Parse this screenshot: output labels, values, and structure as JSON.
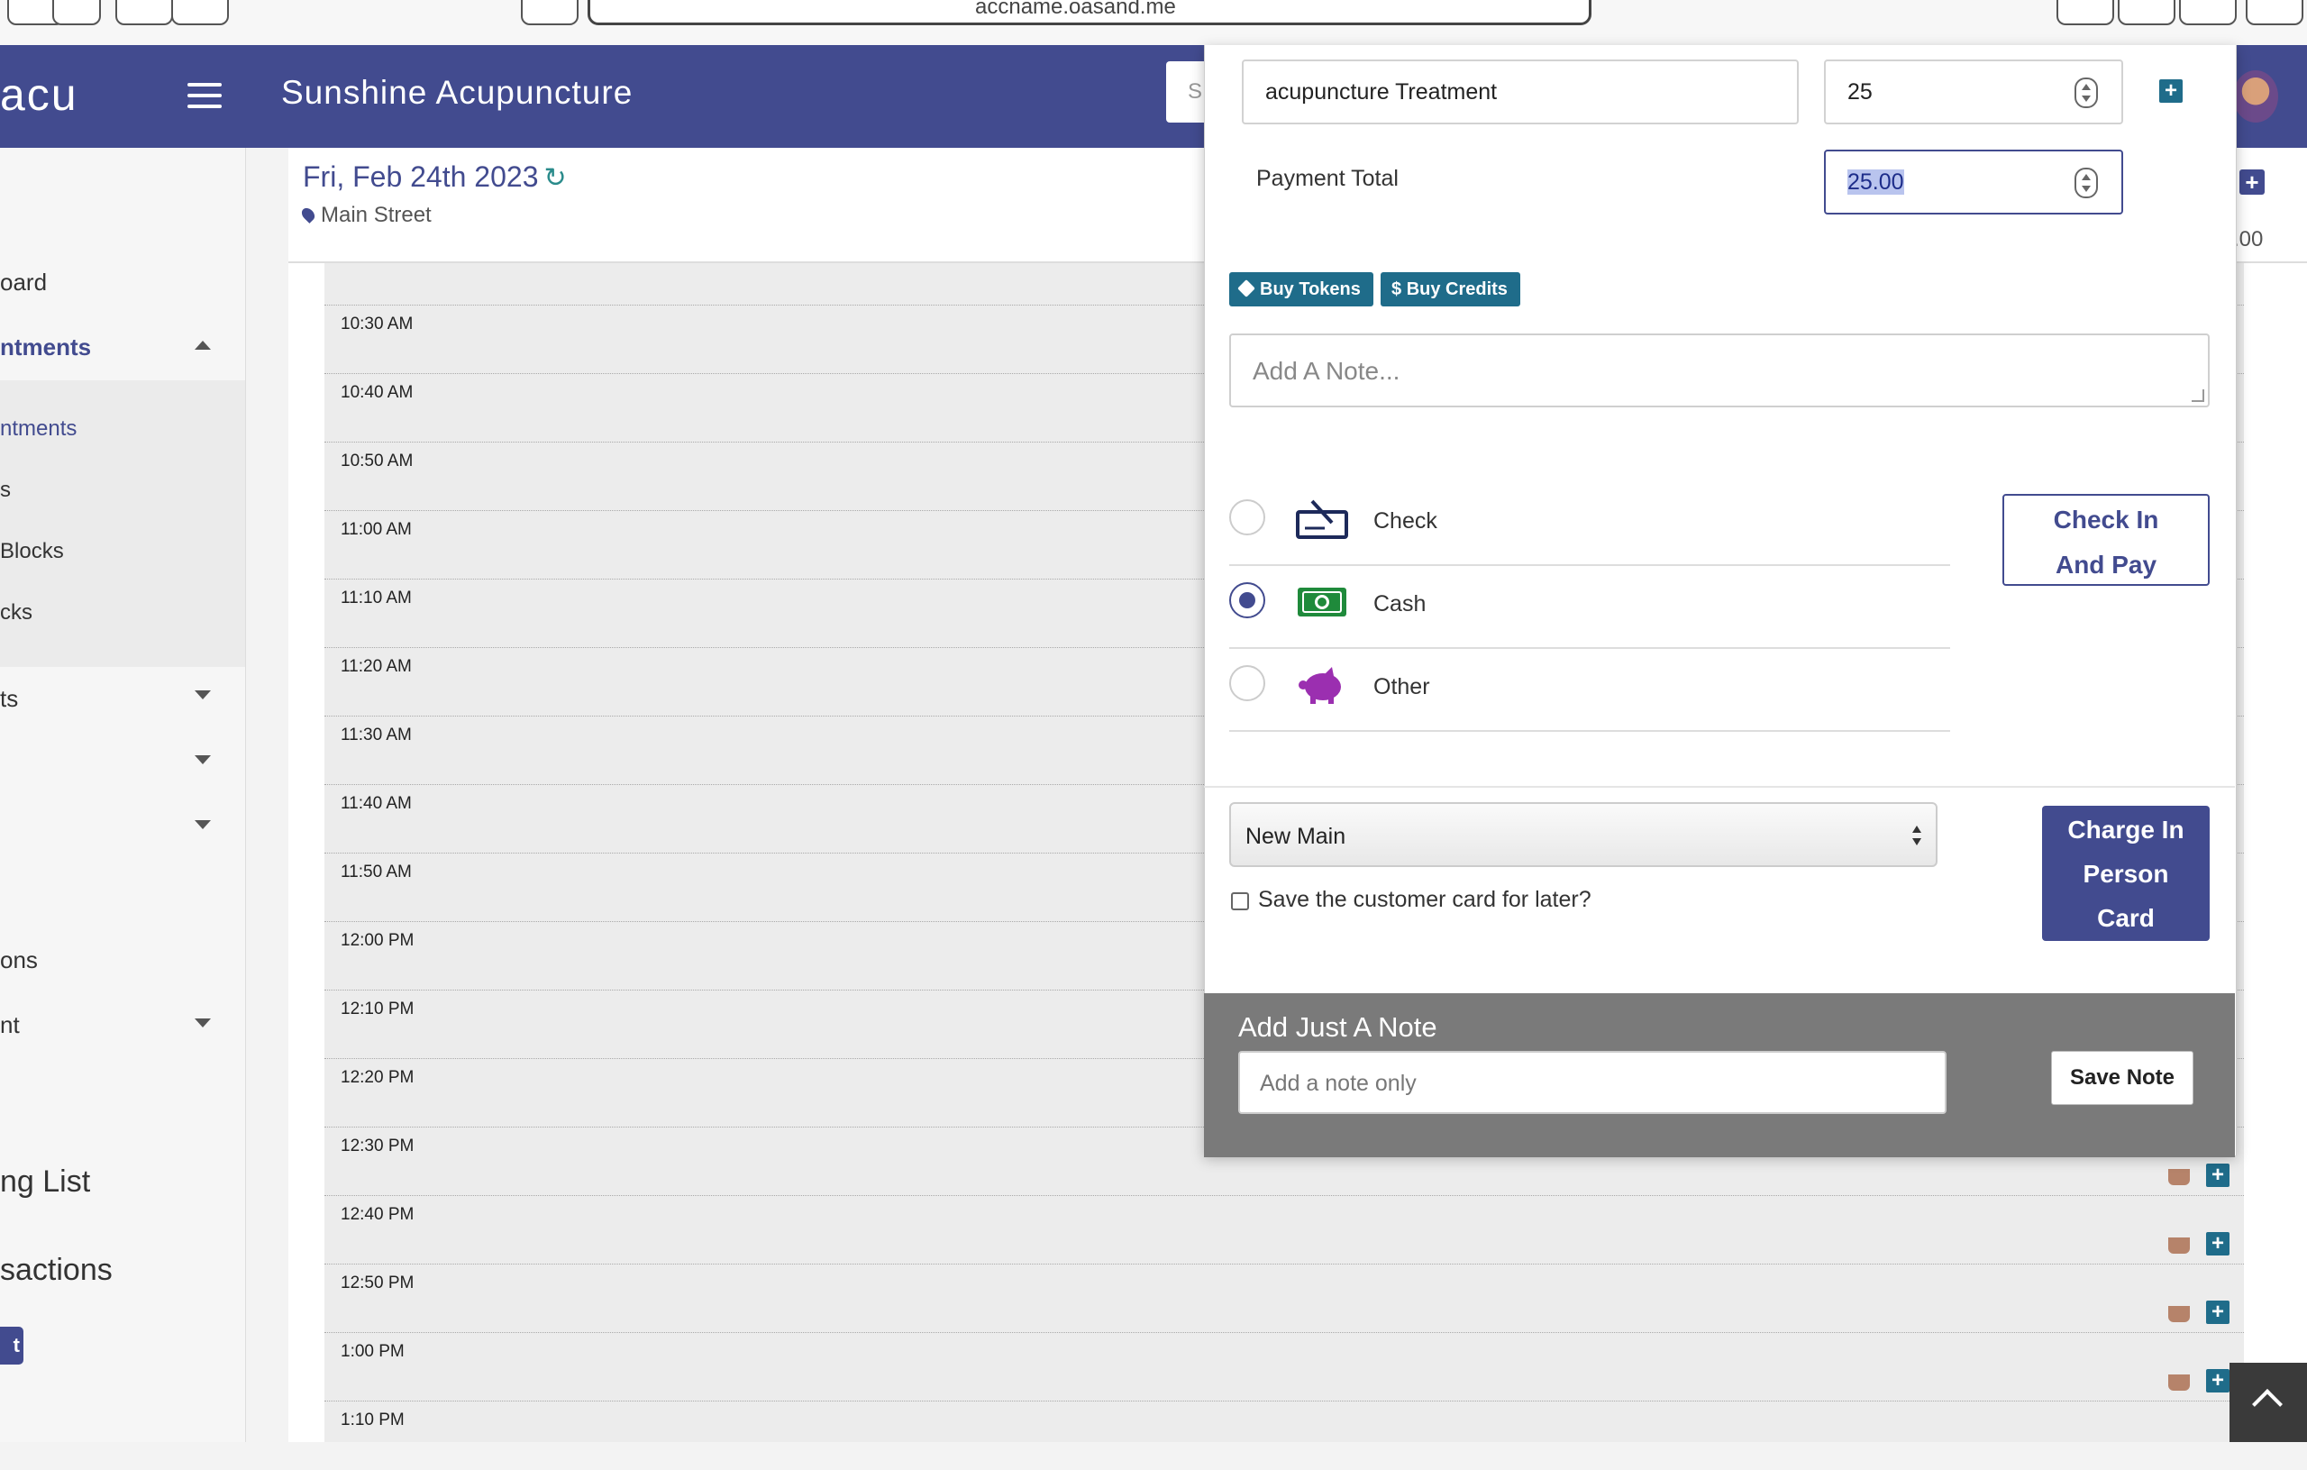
{
  "browser": {
    "url": "accname.oasand.me"
  },
  "header": {
    "logo": "acu",
    "title": "Sunshine Acupuncture",
    "search_placeholder": "S"
  },
  "sidebar": {
    "items": [
      {
        "label": "oard"
      },
      {
        "label": "ntments"
      },
      {
        "label": "ntments"
      },
      {
        "label": "s"
      },
      {
        "label": "Blocks"
      },
      {
        "label": "cks"
      },
      {
        "label": "ts"
      },
      {
        "label": "ons"
      },
      {
        "label": "nt"
      },
      {
        "label": "ng List"
      },
      {
        "label": "sactions"
      }
    ],
    "badge": "t"
  },
  "calendar": {
    "date": "Fri, Feb 24th 2023",
    "location": "Main Street",
    "right_amount": ".00",
    "slots": [
      "10:30 AM",
      "10:40 AM",
      "10:50 AM",
      "11:00 AM",
      "11:10 AM",
      "11:20 AM",
      "11:30 AM",
      "11:40 AM",
      "11:50 AM",
      "12:00 PM",
      "12:10 PM",
      "12:20 PM",
      "12:30 PM",
      "12:40 PM",
      "12:50 PM",
      "1:00 PM",
      "1:10 PM"
    ]
  },
  "payment": {
    "service_name": "acupuncture Treatment",
    "service_qty": "25",
    "total_label": "Payment Total",
    "total_value": "25.00",
    "buy_tokens": "Buy Tokens",
    "buy_credits": "Buy Credits",
    "credits_symbol": "$",
    "note_placeholder": "Add A Note...",
    "methods": [
      {
        "label": "Check",
        "icon": "check-writing-icon",
        "selected": false
      },
      {
        "label": "Cash",
        "icon": "cash-bill-icon",
        "selected": true
      },
      {
        "label": "Other",
        "icon": "piggy-bank-icon",
        "selected": false
      }
    ],
    "check_in_pay": [
      "Check In",
      "And Pay"
    ],
    "card_select": "New Main",
    "save_card_label": "Save the customer card for later?",
    "charge_button": [
      "Charge In",
      "Person",
      "Card"
    ]
  },
  "just_note": {
    "title": "Add Just A Note",
    "placeholder": "Add a note only",
    "save_label": "Save Note"
  },
  "colors": {
    "brand": "#424b8f",
    "teal": "#1f6c8a",
    "cash_green": "#1f8a3b",
    "other_purple": "#9b2fb0",
    "check_navy": "#1d2a5a"
  }
}
